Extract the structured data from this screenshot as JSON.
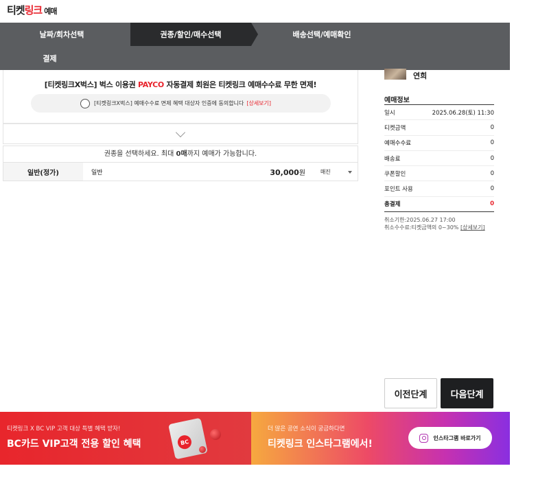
{
  "logo": {
    "brand_black": "티켓",
    "brand_red": "링크",
    "brand_suffix": "예매"
  },
  "steps": [
    {
      "label": "날짜/회차선택"
    },
    {
      "label": "권종/할인/매수선택"
    },
    {
      "label": "배송선택/예매확인"
    },
    {
      "label": "결제"
    }
  ],
  "notice": {
    "title_pre": "[티켓링크X벅스] 벅스 이용권 ",
    "title_highlight": "PAYCO",
    "title_post": " 자동결제 회원은 티켓링크 예매수수료 무한 면제!",
    "agree_text": "[티켓링크X벅스] 예매수수료 면제 혜택 대상자 인증에 동의합니다",
    "agree_link": "[상세보기]"
  },
  "grade": {
    "header_pre": "권종을 선택하세요. 최대 ",
    "header_bold": "0매",
    "header_post": "까지 예매가 가능합니다.",
    "category": "일반(정가)",
    "name": "일반",
    "price": "30,000",
    "price_unit": "원",
    "qty_value": "매진"
  },
  "sidebar": {
    "show_title": "연희",
    "info_title": "예매정보",
    "rows": [
      {
        "label": "일시",
        "value": "2025.06.28(토) 11:30"
      },
      {
        "label": "티켓금액",
        "value": "0"
      },
      {
        "label": "예매수수료",
        "value": "0"
      },
      {
        "label": "배송료",
        "value": "0"
      },
      {
        "label": "쿠폰할인",
        "value": "0"
      },
      {
        "label": "포인트 사용",
        "value": "0"
      },
      {
        "label": "총결제",
        "value": "0"
      }
    ],
    "cancel_deadline": "취소기한:2025.06.27 17:00",
    "cancel_fee": "취소수수료:티켓금액의 0~30% ",
    "cancel_link": "[상세보기]"
  },
  "buttons": {
    "prev": "이전단계",
    "next": "다음단계"
  },
  "banners": {
    "bc_small": "티켓링크 X BC VIP 고객 대상 특별 혜택 받자!",
    "bc_large": "BC카드 VIP고객 전용 할인 혜택",
    "bc_card_logo": "BC",
    "insta_small": "더 많은 공연 소식이 궁금하다면",
    "insta_large": "티켓링크 인스타그램에서!",
    "insta_button": "인스타그램 바로가기"
  },
  "colors": {
    "accent": "#e8232c",
    "stepbar": "#5b5d60",
    "step_active": "#2a2b2d"
  }
}
